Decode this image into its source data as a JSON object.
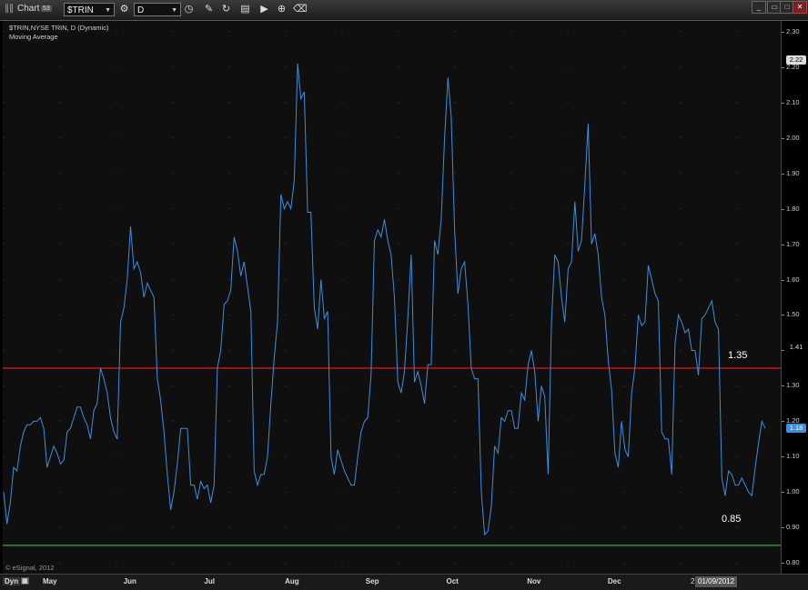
{
  "toolbar": {
    "title": "Chart",
    "title_badge": "53",
    "symbol": "$TRIN",
    "interval": "D"
  },
  "legend": {
    "line1": "$TRIN,NYSE TRIN, D (Dynamic)",
    "line2": "Moving Average"
  },
  "watermark": "© eSignal, 2012",
  "dyn_label": "Dyn",
  "cursor_date": "01/09/2012",
  "cursor_prefix": "2",
  "level_labels": {
    "upper": "1.35",
    "lower": "0.85"
  },
  "colors": {
    "series": "#3a8fe0",
    "upper_line": "#cc1a1a",
    "lower_line": "#1ea81e",
    "background": "#0f0f0f"
  },
  "chart_data": {
    "type": "line",
    "title": "$TRIN,NYSE TRIN, D (Dynamic)",
    "xlabel": "",
    "ylabel": "",
    "ylim": [
      0.77,
      2.33
    ],
    "x_month_labels": [
      "May",
      "Jun",
      "Jul",
      "Aug",
      "Sep",
      "Oct",
      "Nov",
      "Dec"
    ],
    "y_ticks": [
      "2.30",
      "2.20",
      "2.10",
      "2.00",
      "1.90",
      "1.80",
      "1.70",
      "1.60",
      "1.50",
      "1.40",
      "1.30",
      "1.20",
      "1.10",
      "1.00",
      "0.90",
      "0.80"
    ],
    "y_markers": [
      {
        "value": 2.22,
        "label": "2.22",
        "bg": "#dddddd",
        "fg": "#000000"
      },
      {
        "value": 1.41,
        "label": "1.41",
        "bg": "#000000",
        "fg": "#dddddd"
      },
      {
        "value": 1.18,
        "label": "1.18",
        "bg": "#3a8fe0",
        "fg": "#ffffff"
      }
    ],
    "horizontal_lines": [
      {
        "value": 1.35,
        "color": "#cc1a1a"
      },
      {
        "value": 0.85,
        "color": "#1ea81e"
      }
    ],
    "series": [
      {
        "values": [
          1.0,
          0.91,
          0.97,
          1.07,
          1.06,
          1.13,
          1.17,
          1.19,
          1.19,
          1.2,
          1.2,
          1.21,
          1.18,
          1.07,
          1.1,
          1.13,
          1.11,
          1.08,
          1.09,
          1.17,
          1.18,
          1.21,
          1.24,
          1.24,
          1.21,
          1.19,
          1.15,
          1.23,
          1.25,
          1.35,
          1.32,
          1.28,
          1.21,
          1.17,
          1.15,
          1.48,
          1.52,
          1.6,
          1.75,
          1.63,
          1.65,
          1.62,
          1.55,
          1.59,
          1.57,
          1.55,
          1.32,
          1.26,
          1.17,
          1.05,
          0.95,
          1.0,
          1.08,
          1.18,
          1.18,
          1.18,
          1.02,
          1.02,
          0.98,
          1.03,
          1.01,
          1.02,
          0.97,
          1.02,
          1.35,
          1.4,
          1.53,
          1.54,
          1.57,
          1.72,
          1.68,
          1.61,
          1.65,
          1.58,
          1.51,
          1.06,
          1.02,
          1.05,
          1.05,
          1.1,
          1.25,
          1.38,
          1.48,
          1.84,
          1.8,
          1.82,
          1.8,
          1.88,
          2.21,
          2.11,
          2.13,
          1.79,
          1.79,
          1.52,
          1.46,
          1.6,
          1.49,
          1.51,
          1.1,
          1.05,
          1.12,
          1.09,
          1.06,
          1.04,
          1.02,
          1.02,
          1.1,
          1.17,
          1.2,
          1.21,
          1.33,
          1.71,
          1.74,
          1.72,
          1.77,
          1.71,
          1.67,
          1.55,
          1.31,
          1.28,
          1.34,
          1.49,
          1.67,
          1.31,
          1.34,
          1.3,
          1.25,
          1.36,
          1.36,
          1.71,
          1.67,
          1.77,
          2.0,
          2.17,
          2.06,
          1.74,
          1.56,
          1.63,
          1.65,
          1.53,
          1.35,
          1.32,
          1.32,
          1.0,
          0.88,
          0.89,
          0.96,
          1.13,
          1.11,
          1.21,
          1.2,
          1.23,
          1.23,
          1.18,
          1.18,
          1.28,
          1.26,
          1.36,
          1.4,
          1.34,
          1.2,
          1.3,
          1.27,
          1.05,
          1.48,
          1.67,
          1.65,
          1.55,
          1.48,
          1.63,
          1.65,
          1.82,
          1.68,
          1.71,
          1.87,
          2.04,
          1.7,
          1.73,
          1.67,
          1.55,
          1.5,
          1.37,
          1.29,
          1.11,
          1.07,
          1.2,
          1.12,
          1.1,
          1.28,
          1.35,
          1.5,
          1.47,
          1.48,
          1.64,
          1.6,
          1.56,
          1.54,
          1.17,
          1.15,
          1.15,
          1.05,
          1.42,
          1.5,
          1.48,
          1.45,
          1.46,
          1.4,
          1.4,
          1.33,
          1.49,
          1.5,
          1.52,
          1.54,
          1.48,
          1.46,
          1.04,
          0.99,
          1.06,
          1.05,
          1.02,
          1.02,
          1.04,
          1.02,
          1.0,
          0.99,
          1.07,
          1.14,
          1.2,
          1.18
        ]
      }
    ]
  }
}
